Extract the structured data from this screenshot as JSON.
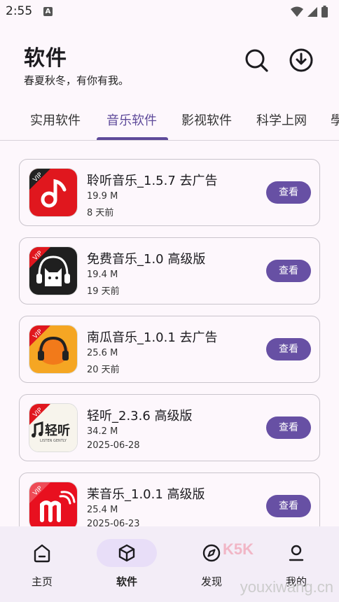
{
  "status": {
    "time": "2:55",
    "notif_letter": "A"
  },
  "header": {
    "title": "软件",
    "subtitle": "春夏秋冬，有你有我。"
  },
  "tabs": [
    {
      "label": "实用软件"
    },
    {
      "label": "音乐软件"
    },
    {
      "label": "影视软件"
    },
    {
      "label": "科学上网"
    },
    {
      "label": "學"
    }
  ],
  "apps": [
    {
      "name": "聆听音乐_1.5.7 去广告",
      "size": "19.9 M",
      "date": "8 天前",
      "button": "查看",
      "icon": "lingting-music-icon",
      "vip": "VIP"
    },
    {
      "name": "免费音乐_1.0 高级版",
      "size": "19.4 M",
      "date": "19 天前",
      "button": "查看",
      "icon": "cat-headphone-icon",
      "vip": "VIP"
    },
    {
      "name": "南瓜音乐_1.0.1 去广告",
      "size": "25.6 M",
      "date": "20 天前",
      "button": "查看",
      "icon": "pumpkin-headphone-icon",
      "vip": "VIP"
    },
    {
      "name": "轻听_2.3.6 高级版",
      "size": "34.2 M",
      "date": "2025-06-28",
      "button": "查看",
      "icon": "qingting-logo-icon",
      "icon_text": "轻听",
      "icon_subtext": "LISTEN GENTLY",
      "vip": "VIP"
    },
    {
      "name": "茉音乐_1.0.1 高级版",
      "size": "25.4 M",
      "date": "2025-06-23",
      "button": "查看",
      "icon": "mo-music-icon",
      "vip": "VIP"
    }
  ],
  "nav": [
    {
      "label": "主页",
      "icon": "home-icon"
    },
    {
      "label": "软件",
      "icon": "cube-icon"
    },
    {
      "label": "发现",
      "icon": "compass-icon"
    },
    {
      "label": "我的",
      "icon": "person-icon"
    }
  ],
  "watermark": {
    "text": "youxiwang.cn",
    "logo": "K5K"
  },
  "colors": {
    "accent": "#6750a4",
    "background": "#fdf7fc",
    "nav_background": "#f3edf7",
    "active_pill": "#e8def8"
  }
}
